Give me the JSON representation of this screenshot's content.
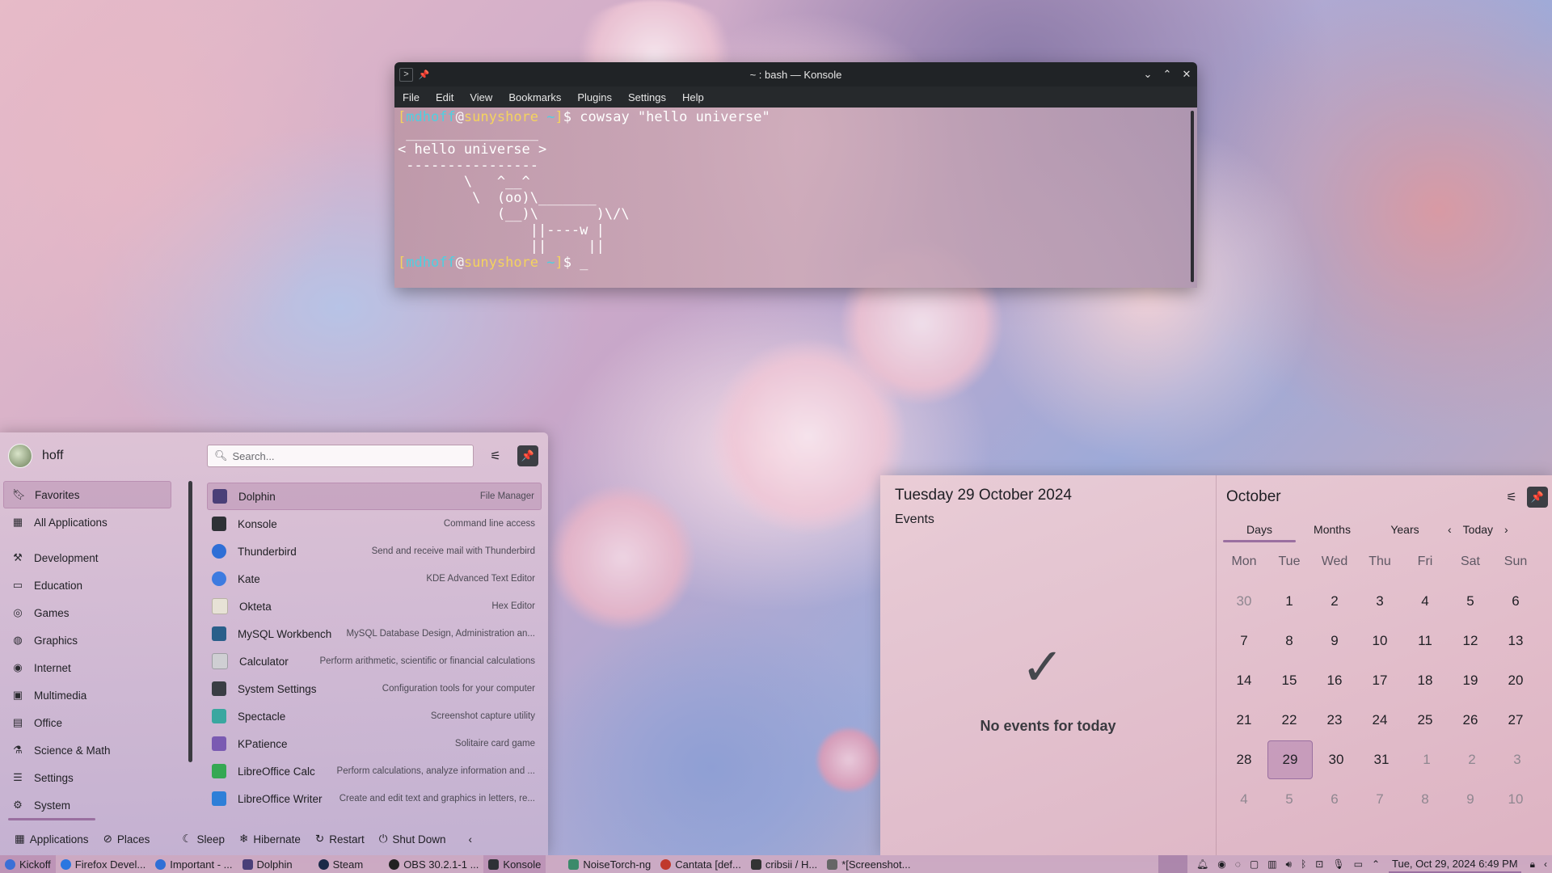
{
  "konsole": {
    "title": "~ : bash — Konsole",
    "menu": [
      "File",
      "Edit",
      "View",
      "Bookmarks",
      "Plugins",
      "Settings",
      "Help"
    ],
    "prompt": {
      "user": "mdhoff",
      "at": "@",
      "host": "sunyshore",
      "dir": "~"
    },
    "command": "cowsay \"hello universe\"",
    "output": " ________________\n< hello universe >\n ----------------\n        \\   ^__^\n         \\  (oo)\\_______\n            (__)\\       )\\/\\\n                ||----w |\n                ||     ||",
    "cursor": "_"
  },
  "kickoff": {
    "username": "hoff",
    "search_placeholder": "Search...",
    "categories": [
      {
        "label": "Favorites",
        "icon": "bookmark-icon"
      },
      {
        "label": "All Applications",
        "icon": "grid-icon"
      },
      {
        "label": "Development",
        "icon": "hammer-icon"
      },
      {
        "label": "Education",
        "icon": "book-icon"
      },
      {
        "label": "Games",
        "icon": "gamepad-icon"
      },
      {
        "label": "Graphics",
        "icon": "palette-icon"
      },
      {
        "label": "Internet",
        "icon": "globe-icon"
      },
      {
        "label": "Multimedia",
        "icon": "film-icon"
      },
      {
        "label": "Office",
        "icon": "briefcase-icon"
      },
      {
        "label": "Science & Math",
        "icon": "flask-icon"
      },
      {
        "label": "Settings",
        "icon": "sliders-icon"
      },
      {
        "label": "System",
        "icon": "gear-icon"
      }
    ],
    "apps": [
      {
        "name": "Dolphin",
        "desc": "File Manager",
        "color": "#4a3f78"
      },
      {
        "name": "Konsole",
        "desc": "Command line access",
        "color": "#2e3136"
      },
      {
        "name": "Thunderbird",
        "desc": "Send and receive mail with Thunderbird",
        "color": "#2f6fd6"
      },
      {
        "name": "Kate",
        "desc": "KDE Advanced Text Editor",
        "color": "#3d7be0"
      },
      {
        "name": "Okteta",
        "desc": "Hex Editor",
        "color": "#e7e2d6"
      },
      {
        "name": "MySQL Workbench",
        "desc": "MySQL Database Design, Administration an...",
        "color": "#2a5f8a"
      },
      {
        "name": "Calculator",
        "desc": "Perform arithmetic, scientific or financial calculations",
        "color": "#cfcfd3"
      },
      {
        "name": "System Settings",
        "desc": "Configuration tools for your computer",
        "color": "#3a3d44"
      },
      {
        "name": "Spectacle",
        "desc": "Screenshot capture utility",
        "color": "#3aa7a0"
      },
      {
        "name": "KPatience",
        "desc": "Solitaire card game",
        "color": "#7a5ab2"
      },
      {
        "name": "LibreOffice Calc",
        "desc": "Perform calculations, analyze information and ...",
        "color": "#35a853"
      },
      {
        "name": "LibreOffice Writer",
        "desc": "Create and edit text and graphics in letters, re...",
        "color": "#2e7fd8"
      }
    ],
    "bottom": {
      "applications": "Applications",
      "places": "Places",
      "sleep": "Sleep",
      "hibernate": "Hibernate",
      "restart": "Restart",
      "shutdown": "Shut Down"
    }
  },
  "calendar": {
    "full_date": "Tuesday 29 October 2024",
    "events_label": "Events",
    "no_events": "No events for today",
    "month": "October",
    "tabs": [
      "Days",
      "Months",
      "Years"
    ],
    "today_label": "Today",
    "weekdays": [
      "Mon",
      "Tue",
      "Wed",
      "Thu",
      "Fri",
      "Sat",
      "Sun"
    ],
    "weeks": [
      [
        "30",
        "1",
        "2",
        "3",
        "4",
        "5",
        "6"
      ],
      [
        "7",
        "8",
        "9",
        "10",
        "11",
        "12",
        "13"
      ],
      [
        "14",
        "15",
        "16",
        "17",
        "18",
        "19",
        "20"
      ],
      [
        "21",
        "22",
        "23",
        "24",
        "25",
        "26",
        "27"
      ],
      [
        "28",
        "29",
        "30",
        "31",
        "1",
        "2",
        "3"
      ],
      [
        "4",
        "5",
        "6",
        "7",
        "8",
        "9",
        "10"
      ]
    ],
    "today": "29"
  },
  "taskbar": {
    "items": [
      {
        "label": "Kickoff",
        "icon": "kde-icon",
        "color": "#3b6fd6"
      },
      {
        "label": "Firefox Devel...",
        "icon": "firefox-icon",
        "color": "#2a77e0"
      },
      {
        "label": "Important - ...",
        "icon": "thunderbird-icon",
        "color": "#2f6fd6"
      },
      {
        "label": "Dolphin",
        "icon": "dolphin-icon",
        "color": "#4a3f78"
      },
      {
        "label": "Steam",
        "icon": "steam-icon",
        "color": "#1b2a48"
      },
      {
        "label": "OBS 30.2.1-1 ...",
        "icon": "obs-icon",
        "color": "#222"
      },
      {
        "label": "Konsole",
        "icon": "konsole-icon",
        "color": "#2e3136"
      },
      {
        "label": "NoiseTorch-ng",
        "icon": "noisetorch-icon",
        "color": "#3b8a6a"
      },
      {
        "label": "Cantata [def...",
        "icon": "cantata-icon",
        "color": "#c0392b"
      },
      {
        "label": "cribsii / H...",
        "icon": "terminal-icon",
        "color": "#333"
      },
      {
        "label": "*[Screenshot...",
        "icon": "spectacle-icon",
        "color": "#666"
      }
    ],
    "clock": "Tue, Oct 29, 2024 6:49 PM"
  }
}
